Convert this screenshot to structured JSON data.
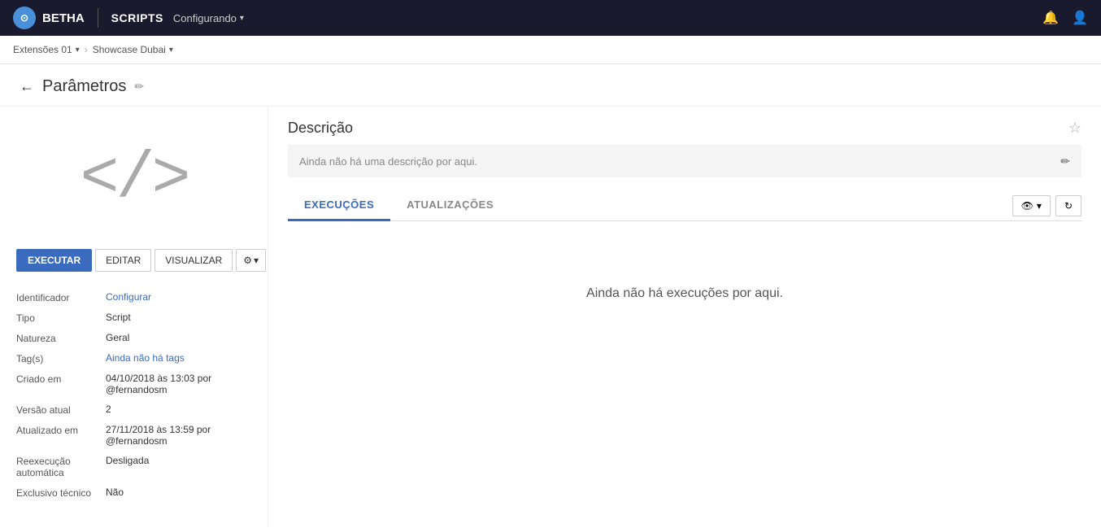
{
  "topbar": {
    "logo_text": "BETHA",
    "scripts_label": "SCRIPTS",
    "menu_label": "Configurando",
    "notification_icon": "🔔",
    "user_icon": "👤"
  },
  "breadcrumb": {
    "item1": "Extensões 01",
    "item2": "Showcase Dubai",
    "chevron": "▾"
  },
  "page": {
    "back_arrow": "←",
    "title": "Parâmetros",
    "edit_icon": "✏"
  },
  "left_panel": {
    "script_icon_html": "&lt;/&gt;",
    "buttons": {
      "execute": "EXECUTAR",
      "edit": "EDITAR",
      "visualize": "VISUALIZAR",
      "settings_icon": "⚙",
      "settings_chevron": "▾"
    },
    "metadata": [
      {
        "label": "Identificador",
        "value": "Configurar",
        "is_link": true
      },
      {
        "label": "Tipo",
        "value": "Script",
        "is_link": false
      },
      {
        "label": "Natureza",
        "value": "Geral",
        "is_link": false
      },
      {
        "label": "Tag(s)",
        "value": "Ainda não há tags",
        "is_link": true
      },
      {
        "label": "Criado em",
        "value": "04/10/2018 às 13:03 por\n@fernandosm",
        "is_link": false
      },
      {
        "label": "Versão atual",
        "value": "2",
        "is_link": false
      },
      {
        "label": "Atualizado em",
        "value": "27/11/2018 às 13:59 por\n@fernandosm",
        "is_link": false
      },
      {
        "label": "Reexecução automática",
        "value": "Desligada",
        "is_link": false
      },
      {
        "label": "Exclusivo técnico",
        "value": "Não",
        "is_link": false
      }
    ]
  },
  "right_panel": {
    "description": {
      "title": "Descrição",
      "star_icon": "☆",
      "empty_text": "Ainda não há uma descrição por aqui.",
      "edit_icon": "✏"
    },
    "tabs": [
      {
        "label": "EXECUÇÕES",
        "active": true
      },
      {
        "label": "ATUALIZAÇÕES",
        "active": false
      }
    ],
    "tab_actions": {
      "eye_icon": "👁",
      "chevron": "▾",
      "refresh_icon": "↻"
    },
    "empty_executions": "Ainda não há execuções por aqui."
  }
}
